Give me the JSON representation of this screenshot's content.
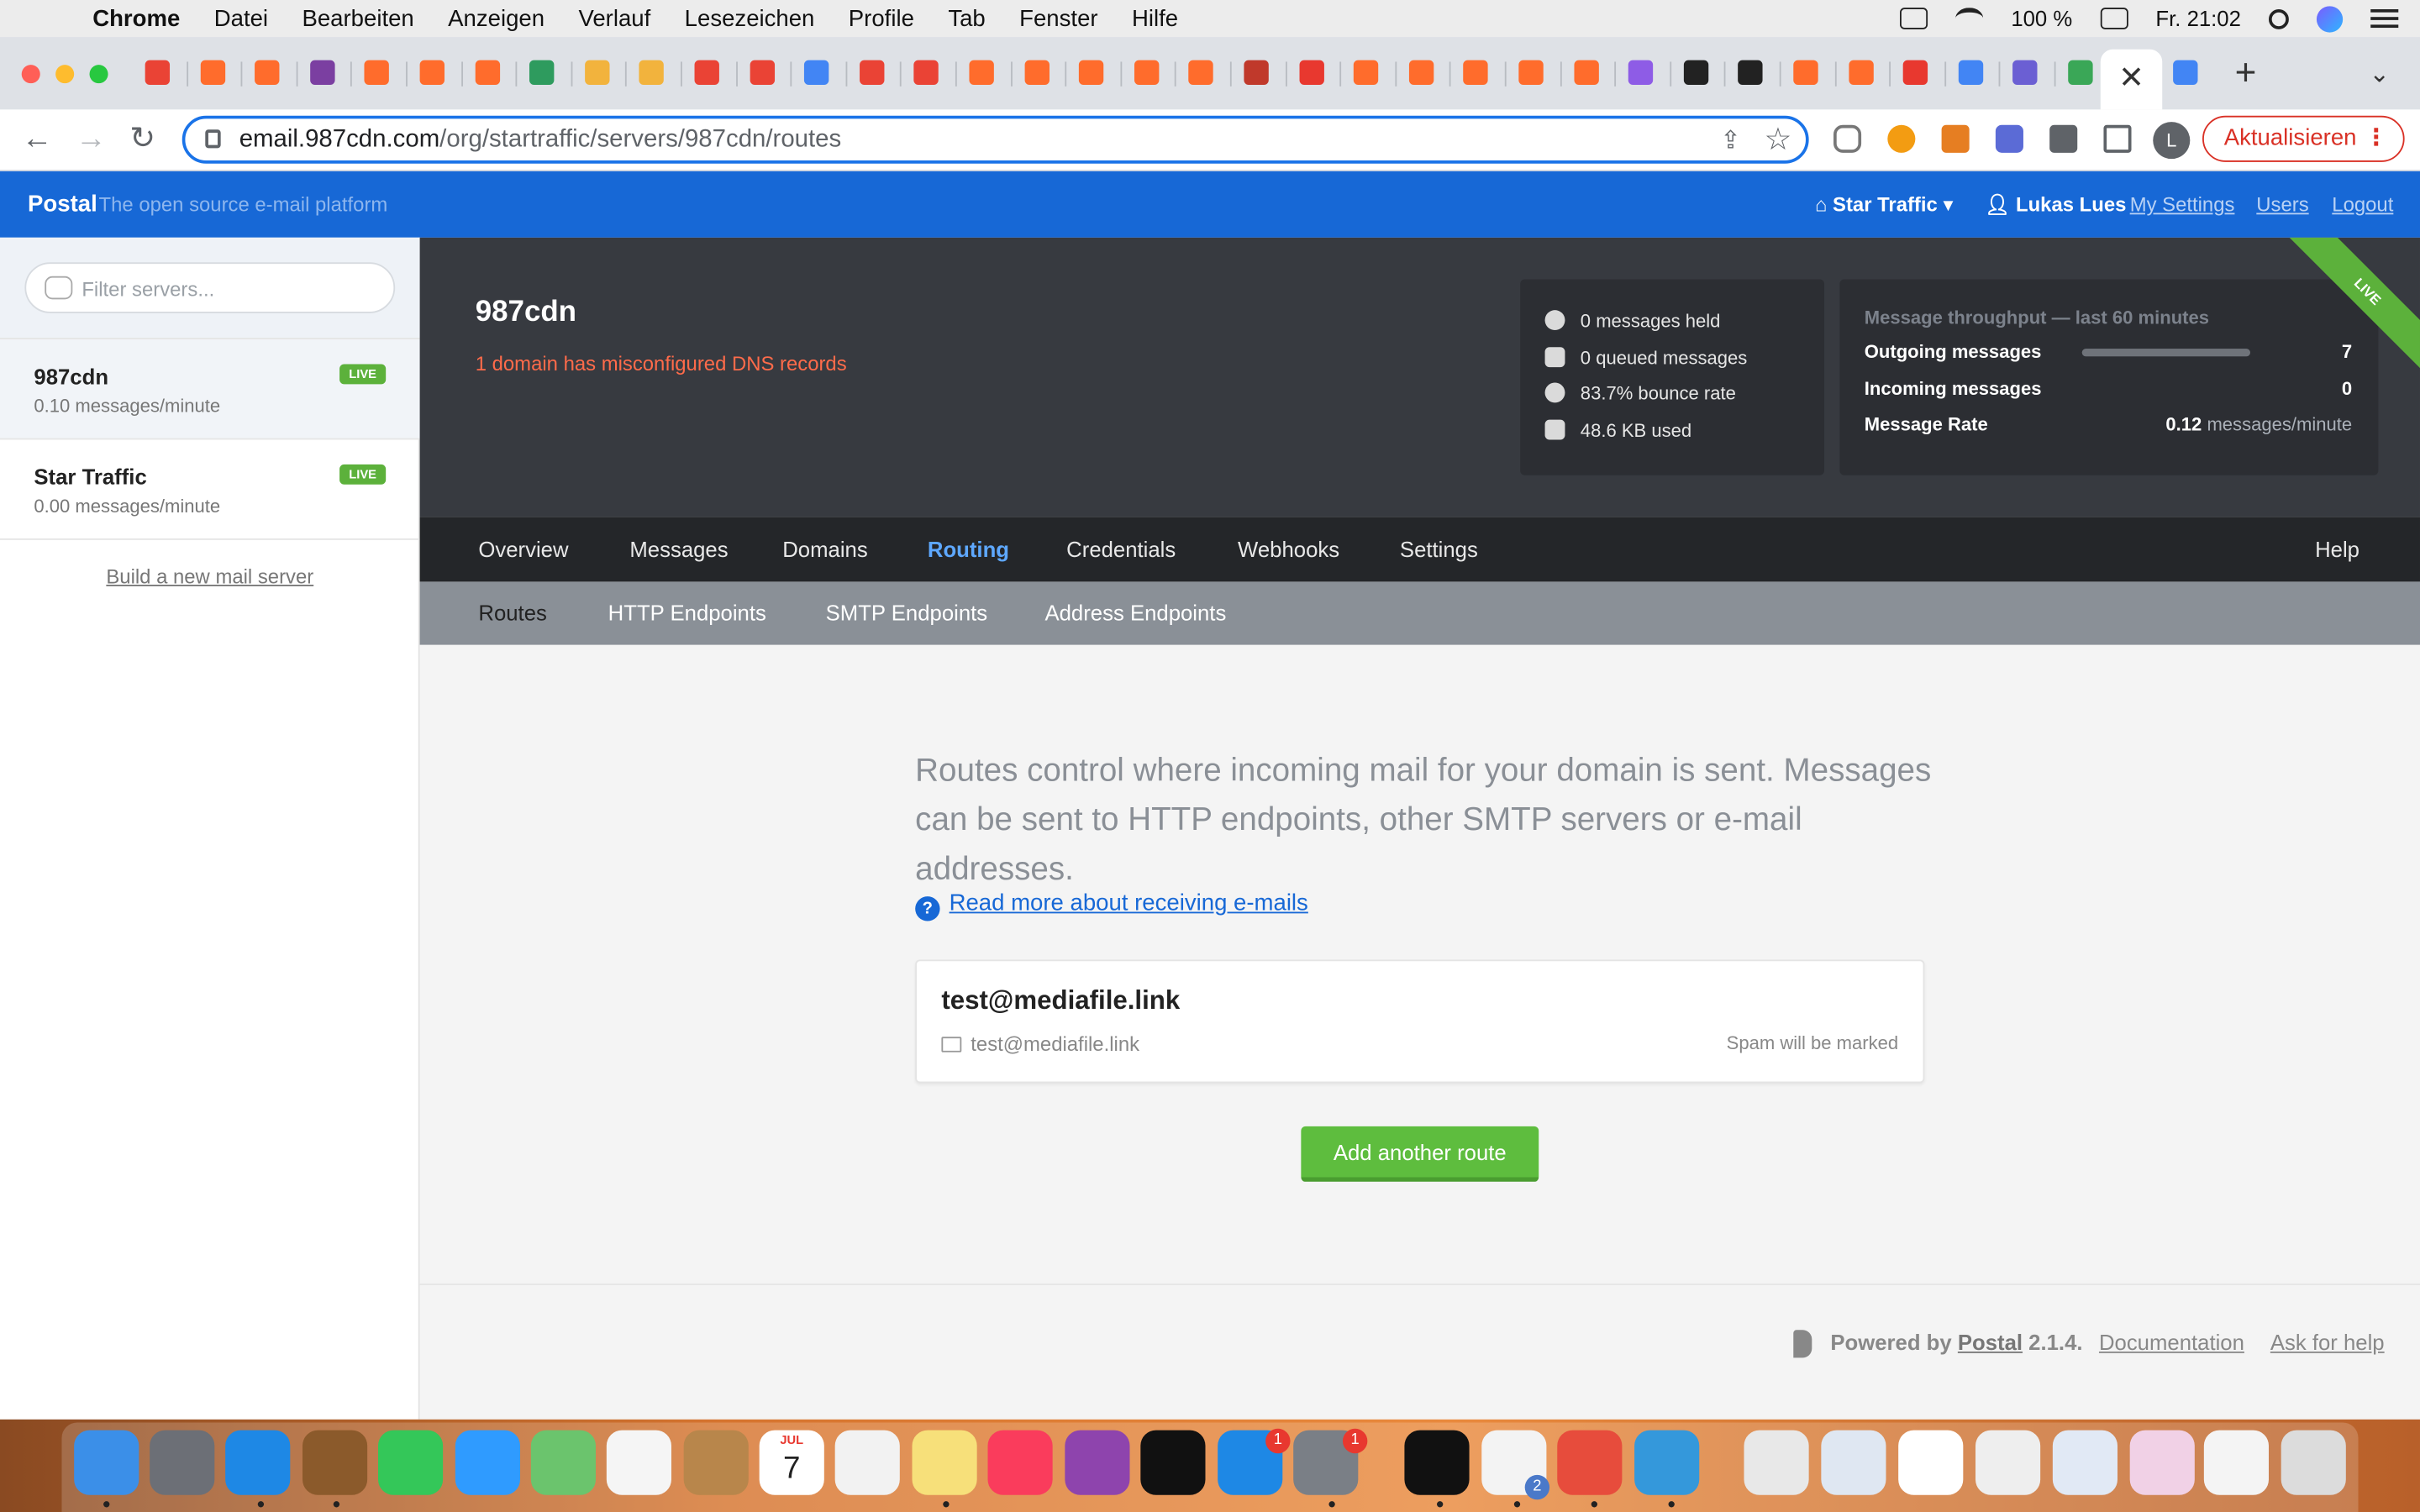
{
  "menubar": {
    "app": "Chrome",
    "items": [
      "Datei",
      "Bearbeiten",
      "Anzeigen",
      "Verlauf",
      "Lesezeichen",
      "Profile",
      "Tab",
      "Fenster",
      "Hilfe"
    ],
    "battery": "100 %",
    "clock": "Fr. 21:02"
  },
  "browser": {
    "url_host": "email.987cdn.com",
    "url_path": "/org/startraffic/servers/987cdn/routes",
    "update_label": "Aktualisieren",
    "profile_initial": "L",
    "active_tab_icon": "close-icon"
  },
  "postal": {
    "brand": "Postal",
    "tagline": "The open source e-mail platform",
    "org": "Star Traffic",
    "user": "Lukas Lues",
    "links": {
      "settings": "My Settings",
      "users": "Users",
      "logout": "Logout"
    }
  },
  "sidebar": {
    "filter_placeholder": "Filter servers...",
    "servers": [
      {
        "name": "987cdn",
        "rate": "0.10 messages/minute",
        "badge": "LIVE"
      },
      {
        "name": "Star Traffic",
        "rate": "0.00 messages/minute",
        "badge": "LIVE"
      }
    ],
    "build_link": "Build a new mail server"
  },
  "server": {
    "name": "987cdn",
    "warning": "1 domain has misconfigured DNS records",
    "ribbon": "LIVE",
    "stats": [
      "0 messages held",
      "0 queued messages",
      "83.7% bounce rate",
      "48.6 KB used"
    ],
    "throughput": {
      "caption": "Message throughput — last 60 minutes",
      "outgoing_label": "Outgoing messages",
      "outgoing_value": "7",
      "incoming_label": "Incoming messages",
      "incoming_value": "0",
      "rate_label": "Message Rate",
      "rate_value": "0.12",
      "rate_unit": "messages/minute"
    }
  },
  "nav": {
    "main": [
      "Overview",
      "Messages",
      "Domains",
      "Routing",
      "Credentials",
      "Webhooks",
      "Settings"
    ],
    "help": "Help",
    "sub": [
      "Routes",
      "HTTP Endpoints",
      "SMTP Endpoints",
      "Address Endpoints"
    ]
  },
  "content": {
    "intro": "Routes control where incoming mail for your domain is sent. Messages can be sent to HTTP endpoints, other SMTP servers or e-mail addresses.",
    "help_link": "Read more about receiving e-mails",
    "route": {
      "name": "test@mediafile.link",
      "destination": "test@mediafile.link",
      "spam": "Spam will be marked"
    },
    "add_button": "Add another route"
  },
  "footer": {
    "powered_prefix": "Powered by",
    "powered_link": "Postal",
    "version": "2.1.4.",
    "docs": "Documentation",
    "help": "Ask for help"
  },
  "dock": {
    "calendar_month": "JUL",
    "calendar_day": "7",
    "badges": [
      "1",
      "1",
      "2"
    ]
  },
  "colors": {
    "postal_blue": "#1768d6",
    "live_green": "#5cb13b",
    "warning_red": "#ff6b4a",
    "active_nav": "#5ea8ff"
  }
}
